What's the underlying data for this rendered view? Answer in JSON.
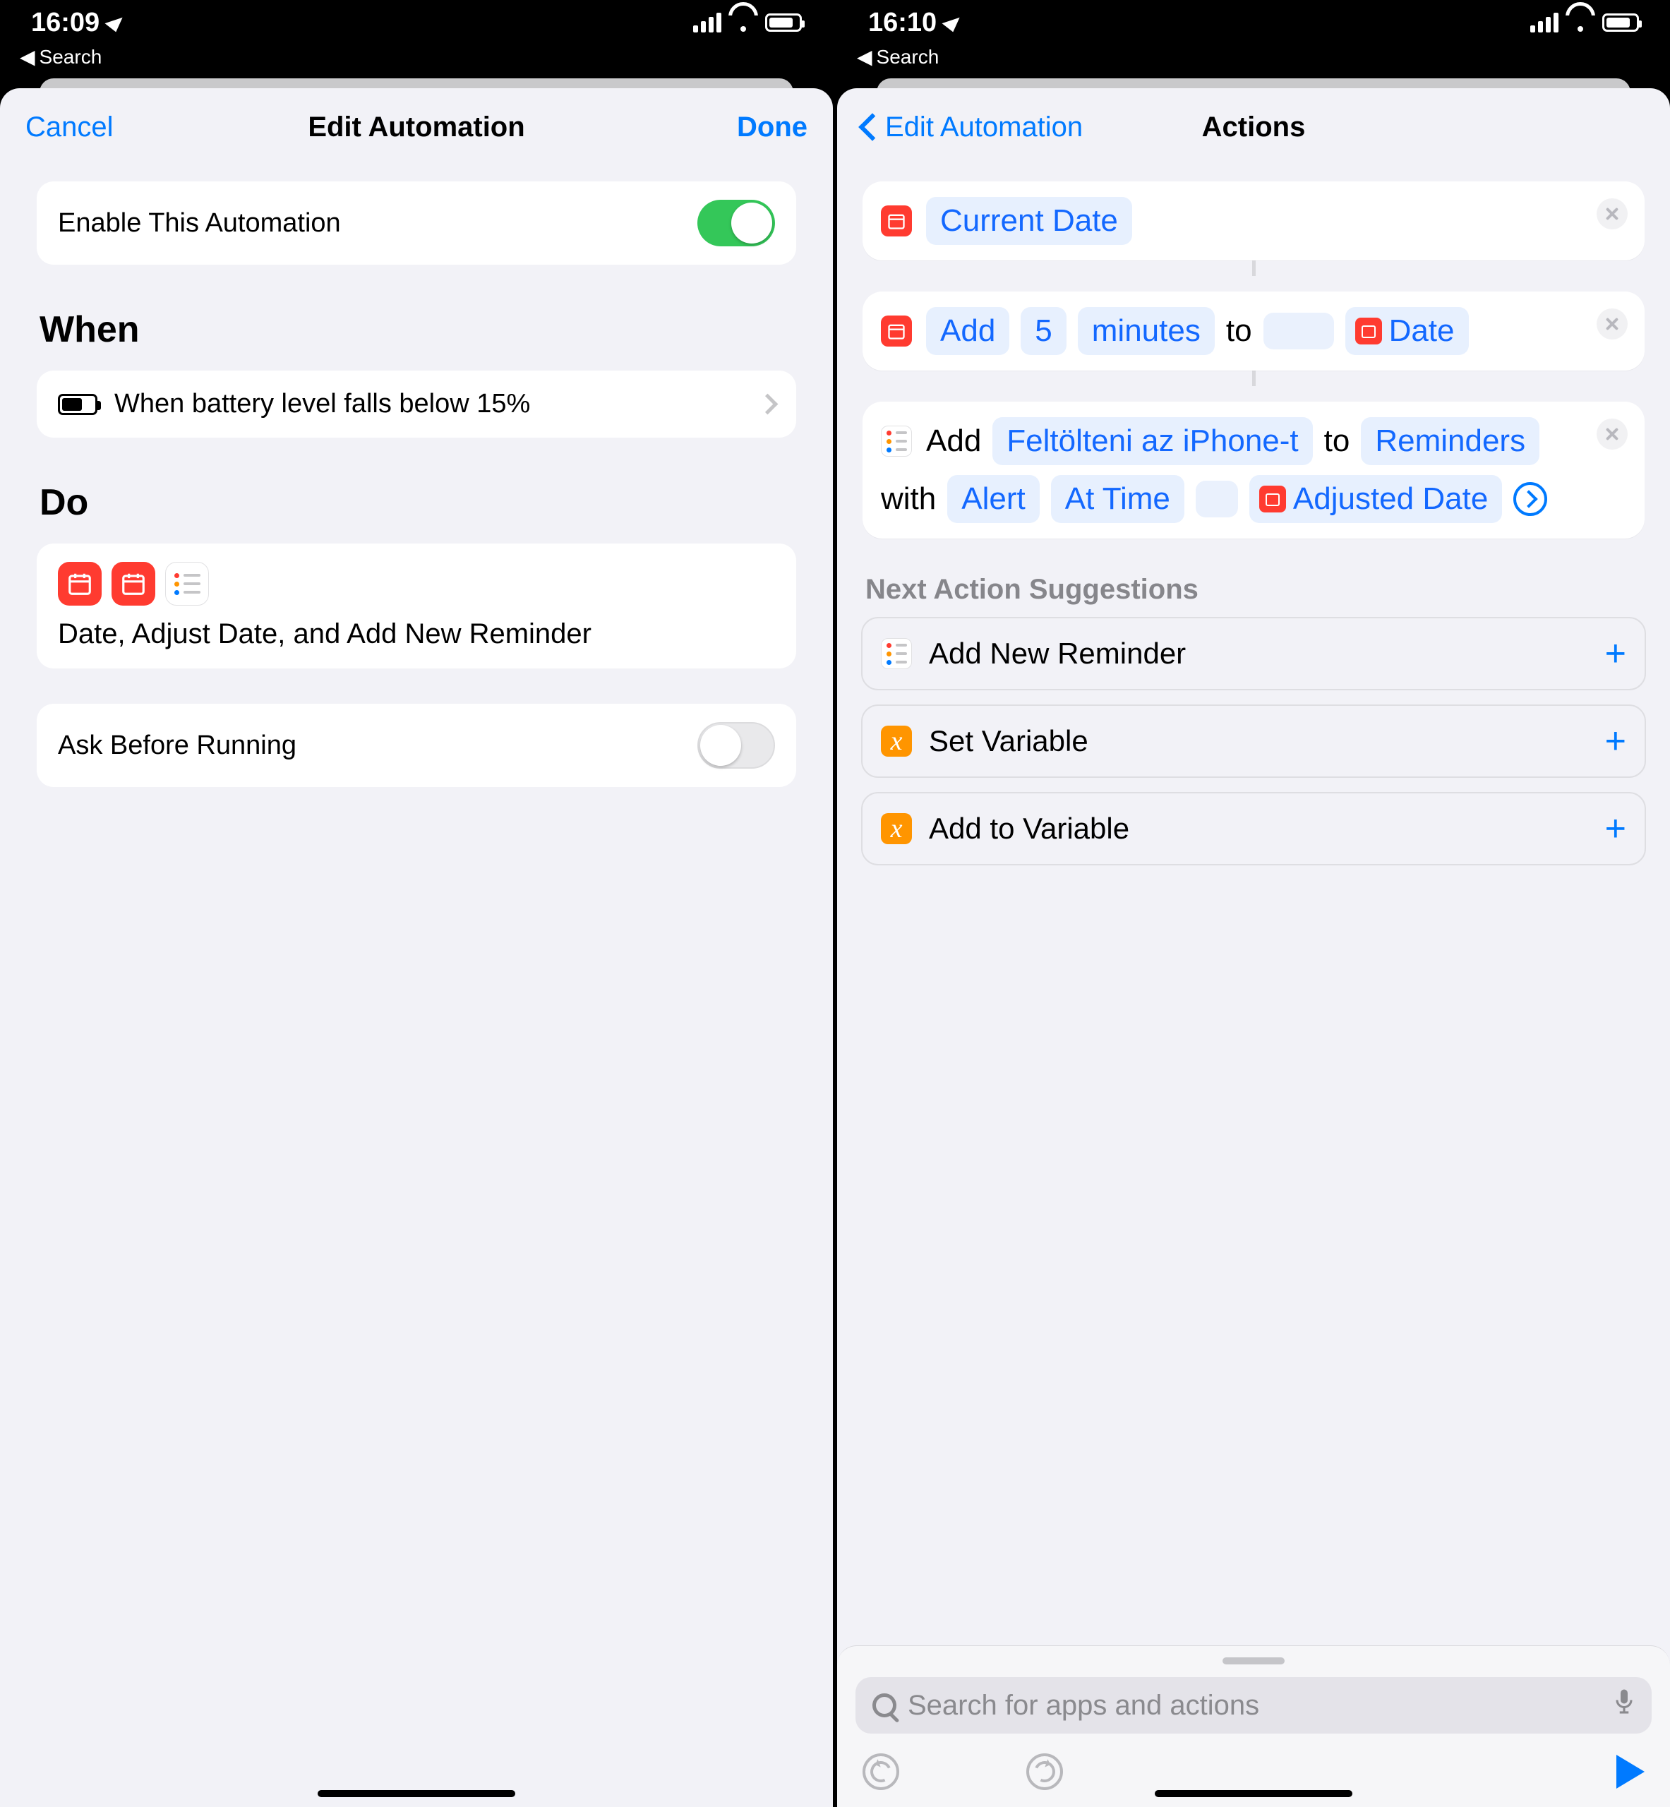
{
  "left": {
    "status": {
      "time": "16:09",
      "back": "Search"
    },
    "nav": {
      "cancel": "Cancel",
      "title": "Edit Automation",
      "done": "Done"
    },
    "enable": {
      "label": "Enable This Automation",
      "on": true
    },
    "when": {
      "heading": "When",
      "text": "When battery level falls below 15%"
    },
    "do": {
      "heading": "Do",
      "text": "Date, Adjust Date, and Add New Reminder"
    },
    "ask": {
      "label": "Ask Before Running",
      "on": false
    }
  },
  "right": {
    "status": {
      "time": "16:10",
      "back": "Search"
    },
    "nav": {
      "back": "Edit Automation",
      "title": "Actions"
    },
    "actions": {
      "step1": {
        "token": "Current Date"
      },
      "step2": {
        "verb": "Add",
        "qty": "5",
        "unit": "minutes",
        "to": "to",
        "varLabel": "Date"
      },
      "step3": {
        "verb": "Add",
        "task": "Feltölteni az iPhone-t",
        "to": "to",
        "list": "Reminders",
        "with": "with",
        "alert": "Alert",
        "atTime": "At Time",
        "varLabel": "Adjusted Date"
      }
    },
    "suggestions": {
      "heading": "Next Action Suggestions",
      "items": [
        "Add New Reminder",
        "Set Variable",
        "Add to Variable"
      ]
    },
    "search": {
      "placeholder": "Search for apps and actions"
    }
  }
}
